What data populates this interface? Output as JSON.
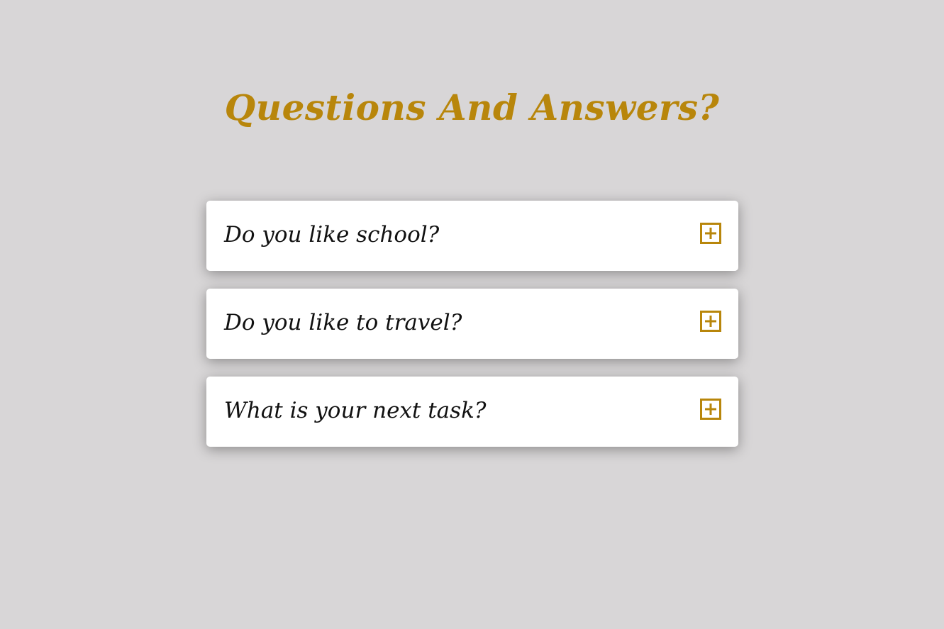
{
  "title": "Questions And Answers?",
  "colors": {
    "background": "#d8d6d7",
    "accent": "#b8860b",
    "card": "#ffffff",
    "question_text": "#111111"
  },
  "faq": {
    "items": [
      {
        "question": "Do you like school?",
        "icon": "plus-square-icon"
      },
      {
        "question": "Do you like to travel?",
        "icon": "plus-square-icon"
      },
      {
        "question": "What is your next task?",
        "icon": "plus-square-icon"
      }
    ]
  }
}
